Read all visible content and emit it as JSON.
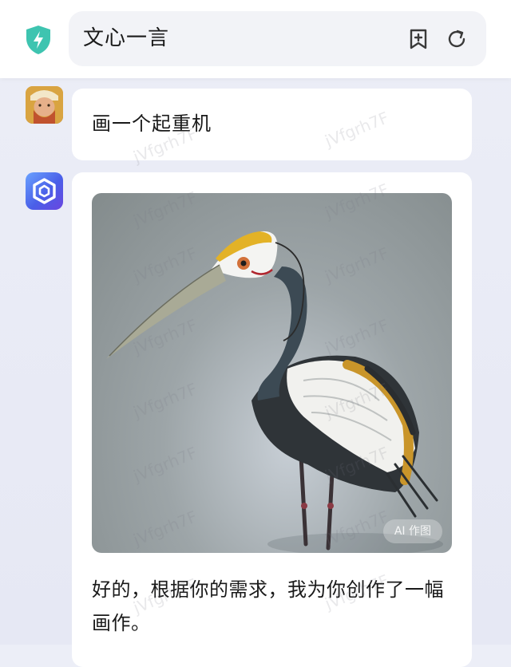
{
  "header": {
    "title": "文心一言",
    "shield_icon": "shield-bolt-icon",
    "new_chat_icon": "bookmark-plus-icon",
    "refresh_icon": "refresh-icon",
    "accent_color": "#3ec4b0"
  },
  "conversation": {
    "user_message": {
      "avatar": "user-avatar",
      "text": "画一个起重机"
    },
    "bot_message": {
      "avatar": "ernie-bot-avatar",
      "image_alt": "crane-bird-illustration",
      "image_badge": "AI 作图",
      "text": "好的，根据你的需求，我为你创作了一幅画作。"
    }
  },
  "watermark": "jVfgrh7F"
}
